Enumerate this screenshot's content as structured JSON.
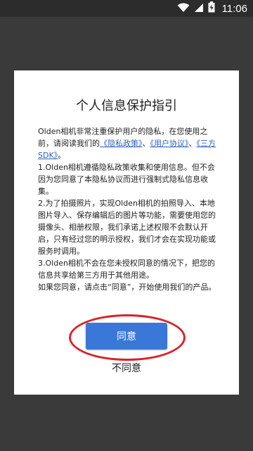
{
  "status_bar": {
    "time": "11:06",
    "icons": [
      "wifi-icon",
      "signal-icon",
      "battery-charging-icon"
    ]
  },
  "dialog": {
    "title": "个人信息保护指引",
    "p1_prefix": "Olden相机非常注重保护用户的隐私，在您使用之前，请阅读我们的",
    "link_privacy": "《隐私政策》",
    "sep1": "、",
    "link_user": "《用户协议》",
    "sep2": "、",
    "link_sdk": "《三方SDK》",
    "p1_suffix": "。",
    "p2": "1.Olden相机遵循隐私政策收集和使用信息。但不会因为您同意了本隐私协议而进行强制式隐私信息收集。",
    "p3": "2.为了拍摄照片，实现Olden相机的拍照导入、本地图片导入、保存编辑后的图片等功能，需要使用您的摄像头、相册权限，我们承诺上述权限不会默认开启，只有经过您的明示授权，我们才会在实现功能或服务时调用。",
    "p4": "3.Olden相机不会在您未授权同意的情况下，把您的信息共享给第三方用于其他用途。",
    "p5": "如果您同意，请点击“同意”，开始使用我们的产品。",
    "agree_label": "同意",
    "disagree_label": "不同意"
  },
  "colors": {
    "accent": "#3a78d8",
    "link": "#2b62c0",
    "highlight": "#d8232a",
    "overlay": "#3a3a3a"
  }
}
